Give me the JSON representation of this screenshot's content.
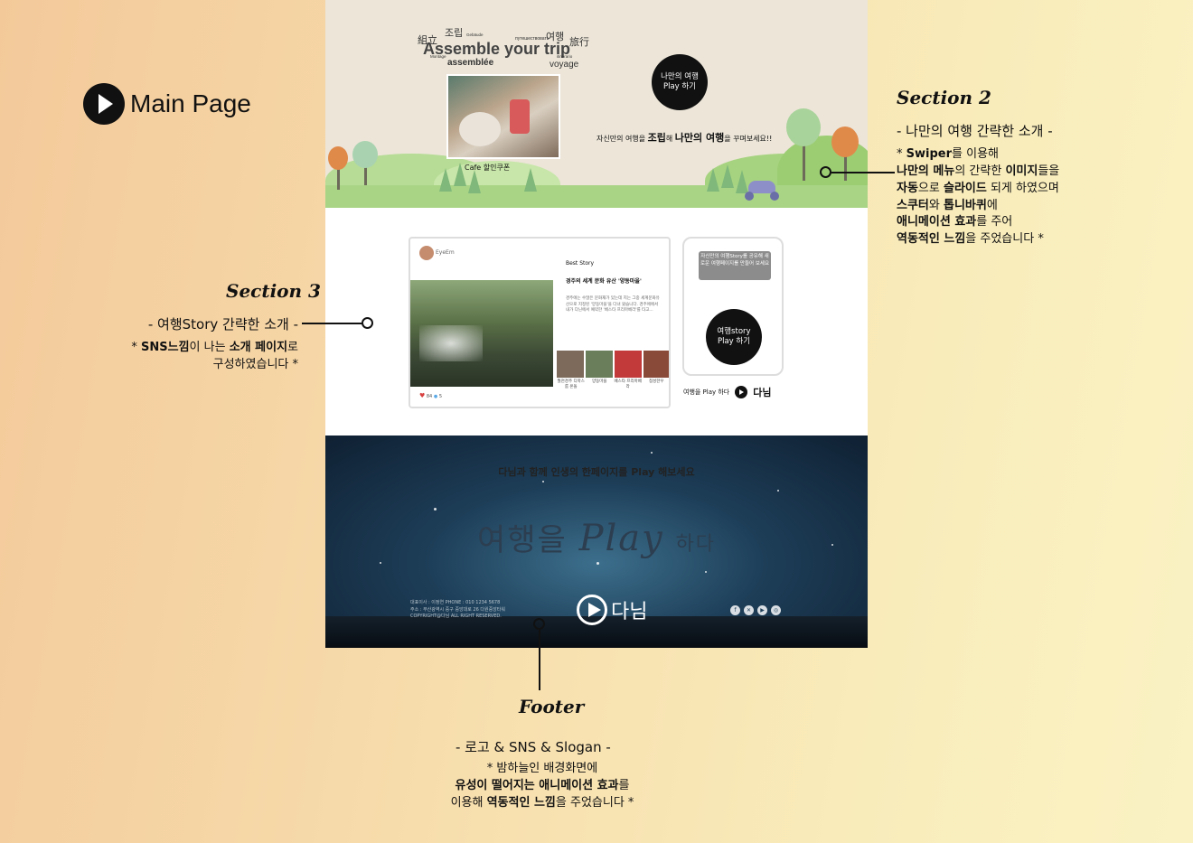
{
  "header": {
    "title": "Main Page"
  },
  "section2": {
    "word_cloud": [
      "組立",
      "조립",
      "Assemble your trip",
      "assemblée",
      "voyage",
      "путешествовать",
      "여행",
      "旅行",
      "Montage",
      "itinerario",
      "Gebäude"
    ],
    "photo_caption": "Cafe 할인쿠폰",
    "play_button": [
      "나만의 여행",
      "Play 하기"
    ],
    "tagline_parts": [
      "자신만의 여행을 ",
      "조립",
      "해 ",
      "나만의 여행",
      "을 꾸며보세요!!"
    ]
  },
  "section3": {
    "card": {
      "user": "EyeEm",
      "label": "Best Story",
      "headline": "경주의 세계 문화 유산 '양동마을'",
      "body": "경주에는 수많은 문화재가 있는데 지는 그중 세계문화유산으로 지정된 '양동마을'을 다녀 왔습니다. 경주에에서 내가 다닌에서 예약한 '베스타 프리마베라'를 타고...",
      "thumb_labels": [
        "월천경주 디학스룸 온돌",
        "양동마을",
        "베스타 프리마베라",
        "첨성한우"
      ],
      "likes": "84",
      "comments": "5"
    },
    "share_note": "자신만의 여행Story를 공유해 새로운 여행페이지를 만들어 보세요",
    "story_button": [
      "여행story",
      "Play 하기"
    ],
    "slogan": "여행을 Play 하다",
    "logo_text": "다님"
  },
  "footer": {
    "top_text": "다님과 함께 인생의 한페이지를 Play 해보세요",
    "big_slogan": {
      "pre": "여행을",
      "play": "Play",
      "post": "하다"
    },
    "info_lines": [
      "대표이사 : 이정연 PHONE : 010 1234 5678",
      "주소 : 부산광역시 중구 중앙대로 26 다원중앙타워",
      "COPYRIGHT@다님 ALL RIGHT RESERVED."
    ],
    "logo_text": "다님",
    "sns_icons": [
      "facebook-icon",
      "x-icon",
      "youtube-icon",
      "instagram-icon"
    ]
  },
  "annotations": {
    "section2": {
      "title": "Section 2",
      "subtitle": "- 나만의 여행 간략한 소개 -",
      "lines": [
        [
          {
            "t": "* ",
            "b": false
          },
          {
            "t": "Swiper",
            "b": true
          },
          {
            "t": "를 이용해",
            "b": false
          }
        ],
        [
          {
            "t": "나만의 메뉴",
            "b": true
          },
          {
            "t": "의 간략한 ",
            "b": false
          },
          {
            "t": "이미지",
            "b": true
          },
          {
            "t": "들을",
            "b": false
          }
        ],
        [
          {
            "t": "자동",
            "b": true
          },
          {
            "t": "으로 ",
            "b": false
          },
          {
            "t": "슬라이드",
            "b": true
          },
          {
            "t": " 되게 하였으며",
            "b": false
          }
        ],
        [
          {
            "t": "스쿠터",
            "b": true
          },
          {
            "t": "와 ",
            "b": false
          },
          {
            "t": "톱니바퀴",
            "b": true
          },
          {
            "t": "에",
            "b": false
          }
        ],
        [
          {
            "t": "애니메이션 효과",
            "b": true
          },
          {
            "t": "를 주어",
            "b": false
          }
        ],
        [
          {
            "t": "역동적인 느낌",
            "b": true
          },
          {
            "t": "을 주었습니다 *",
            "b": false
          }
        ]
      ]
    },
    "section3": {
      "title": "Section 3",
      "subtitle": "- 여행Story 간략한 소개 -",
      "lines": [
        [
          {
            "t": "* ",
            "b": false
          },
          {
            "t": "SNS느낌",
            "b": true
          },
          {
            "t": "이 나는 ",
            "b": false
          },
          {
            "t": "소개 페이지",
            "b": true
          },
          {
            "t": "로",
            "b": false
          }
        ],
        [
          {
            "t": "구성하였습니다 *",
            "b": false
          }
        ]
      ]
    },
    "footer": {
      "title": "Footer",
      "subtitle": "- 로고 & SNS & Slogan -",
      "lines": [
        [
          {
            "t": "* 밤하늘인 배경화면에",
            "b": false
          }
        ],
        [
          {
            "t": "유성이 떨어지는 애니메이션 효과",
            "b": true
          },
          {
            "t": "를",
            "b": false
          }
        ],
        [
          {
            "t": "이용해 ",
            "b": false
          },
          {
            "t": "역동적인 느낌",
            "b": true
          },
          {
            "t": "을 주었습니다 *",
            "b": false
          }
        ]
      ]
    }
  },
  "colors": {
    "background_start": "#f3c99a",
    "background_end": "#faf2c3",
    "section2_bg": "#ece5d8",
    "footer_sky": "#1d3d57",
    "accent_black": "#111111"
  }
}
